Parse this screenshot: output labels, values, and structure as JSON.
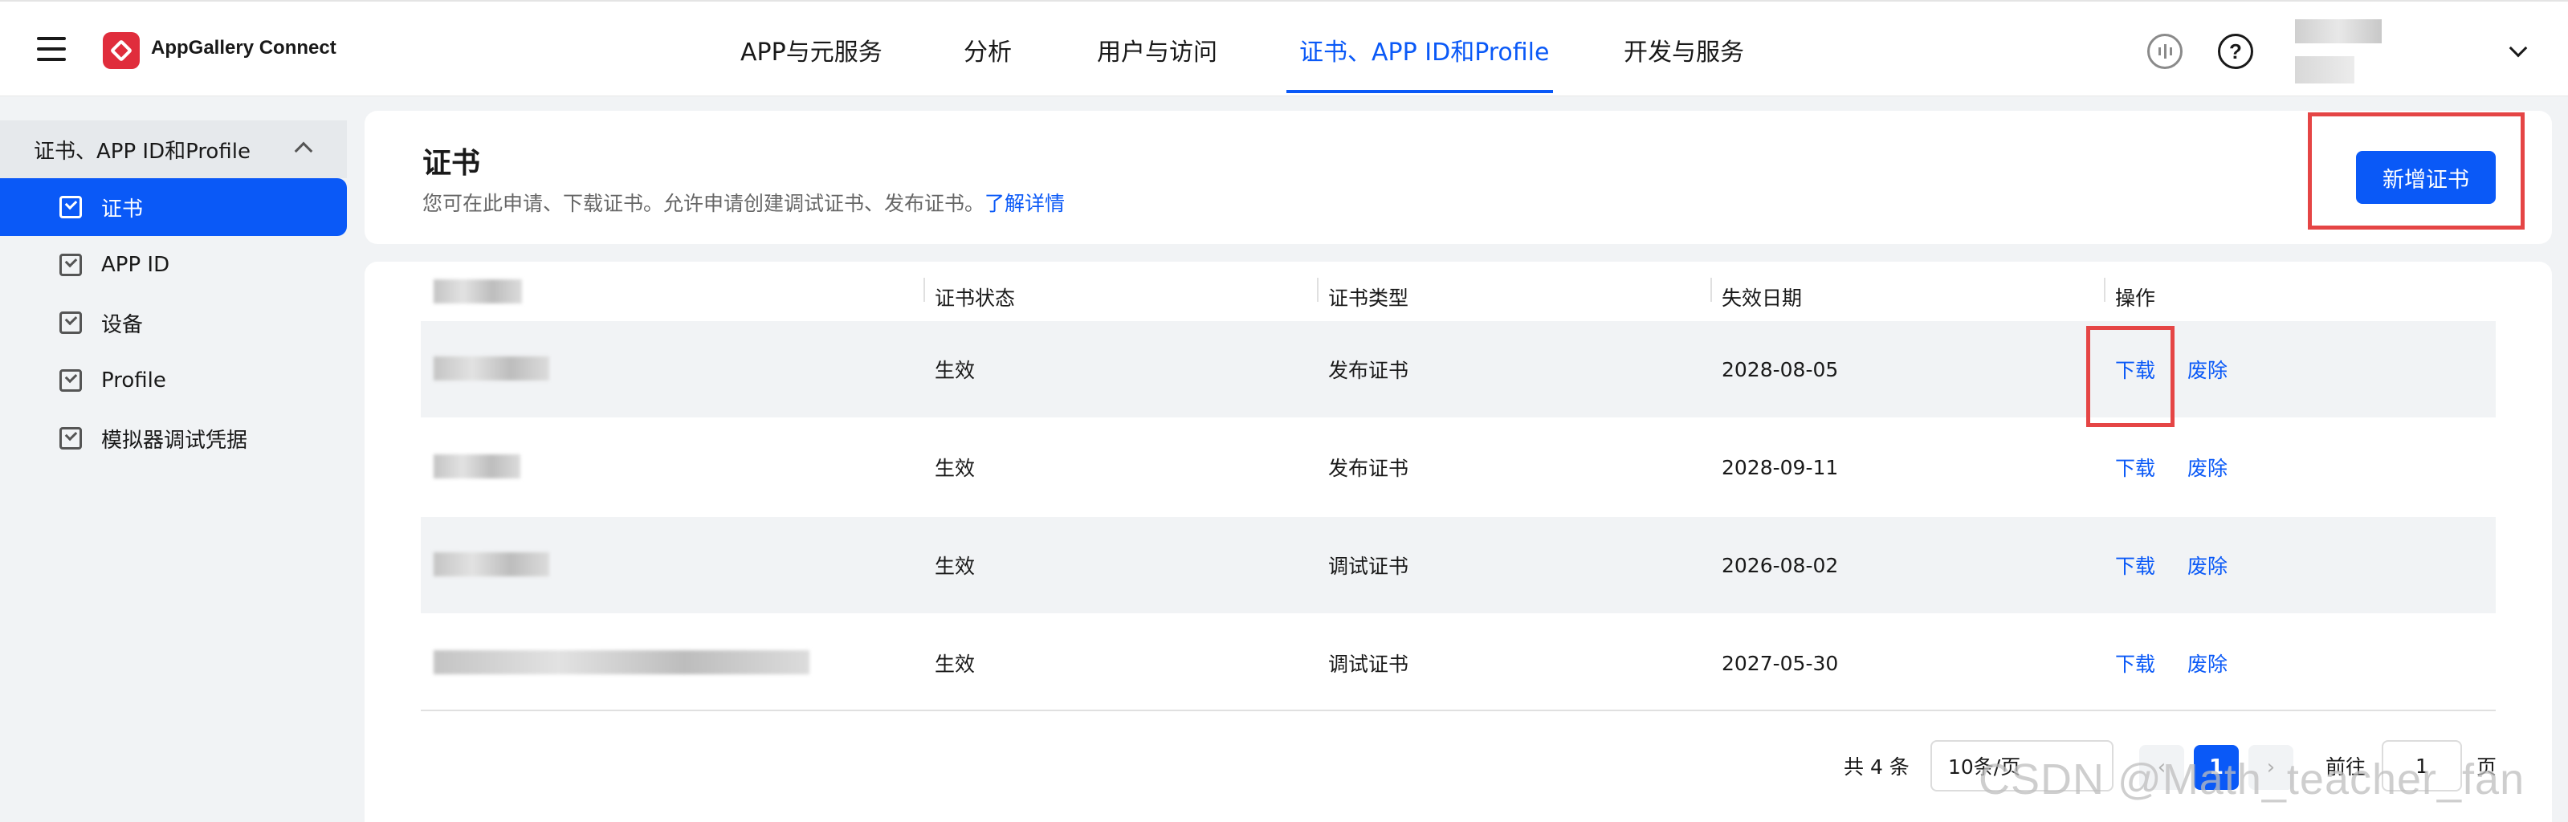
{
  "header": {
    "brand": "AppGallery Connect",
    "nav": [
      {
        "label": "APP与元服务"
      },
      {
        "label": "分析"
      },
      {
        "label": "用户与访问"
      },
      {
        "label": "证书、APP ID和Profile"
      },
      {
        "label": "开发与服务"
      }
    ],
    "help_icon": "?"
  },
  "sidebar": {
    "group_label": "证书、APP ID和Profile",
    "items": [
      {
        "label": "证书"
      },
      {
        "label": "APP ID"
      },
      {
        "label": "设备"
      },
      {
        "label": "Profile"
      },
      {
        "label": "模拟器调试凭据"
      }
    ]
  },
  "page": {
    "title": "证书",
    "subtitle": "您可在此申请、下载证书。允许申请创建调试证书、发布证书。",
    "subtitle_link": "了解详情",
    "add_button": "新增证书"
  },
  "table": {
    "headers": [
      "证书状态",
      "证书类型",
      "失效日期",
      "操作"
    ],
    "rows": [
      {
        "status": "生效",
        "type": "发布证书",
        "expiry": "2028-08-05",
        "download": "下载",
        "revoke": "废除"
      },
      {
        "status": "生效",
        "type": "发布证书",
        "expiry": "2028-09-11",
        "download": "下载",
        "revoke": "废除"
      },
      {
        "status": "生效",
        "type": "调试证书",
        "expiry": "2026-08-02",
        "download": "下载",
        "revoke": "废除"
      },
      {
        "status": "生效",
        "type": "调试证书",
        "expiry": "2027-05-30",
        "download": "下载",
        "revoke": "废除"
      }
    ]
  },
  "pagination": {
    "total_text": "共 4 条",
    "page_size": "10条/页",
    "current_page": "1",
    "goto_label": "前往",
    "goto_value": "1",
    "page_suffix": "页"
  },
  "watermark": "CSDN @Math_teacher_fan",
  "colors": {
    "accent": "#0a59f7",
    "brand": "#e02d3c",
    "highlight": "#e54545"
  }
}
